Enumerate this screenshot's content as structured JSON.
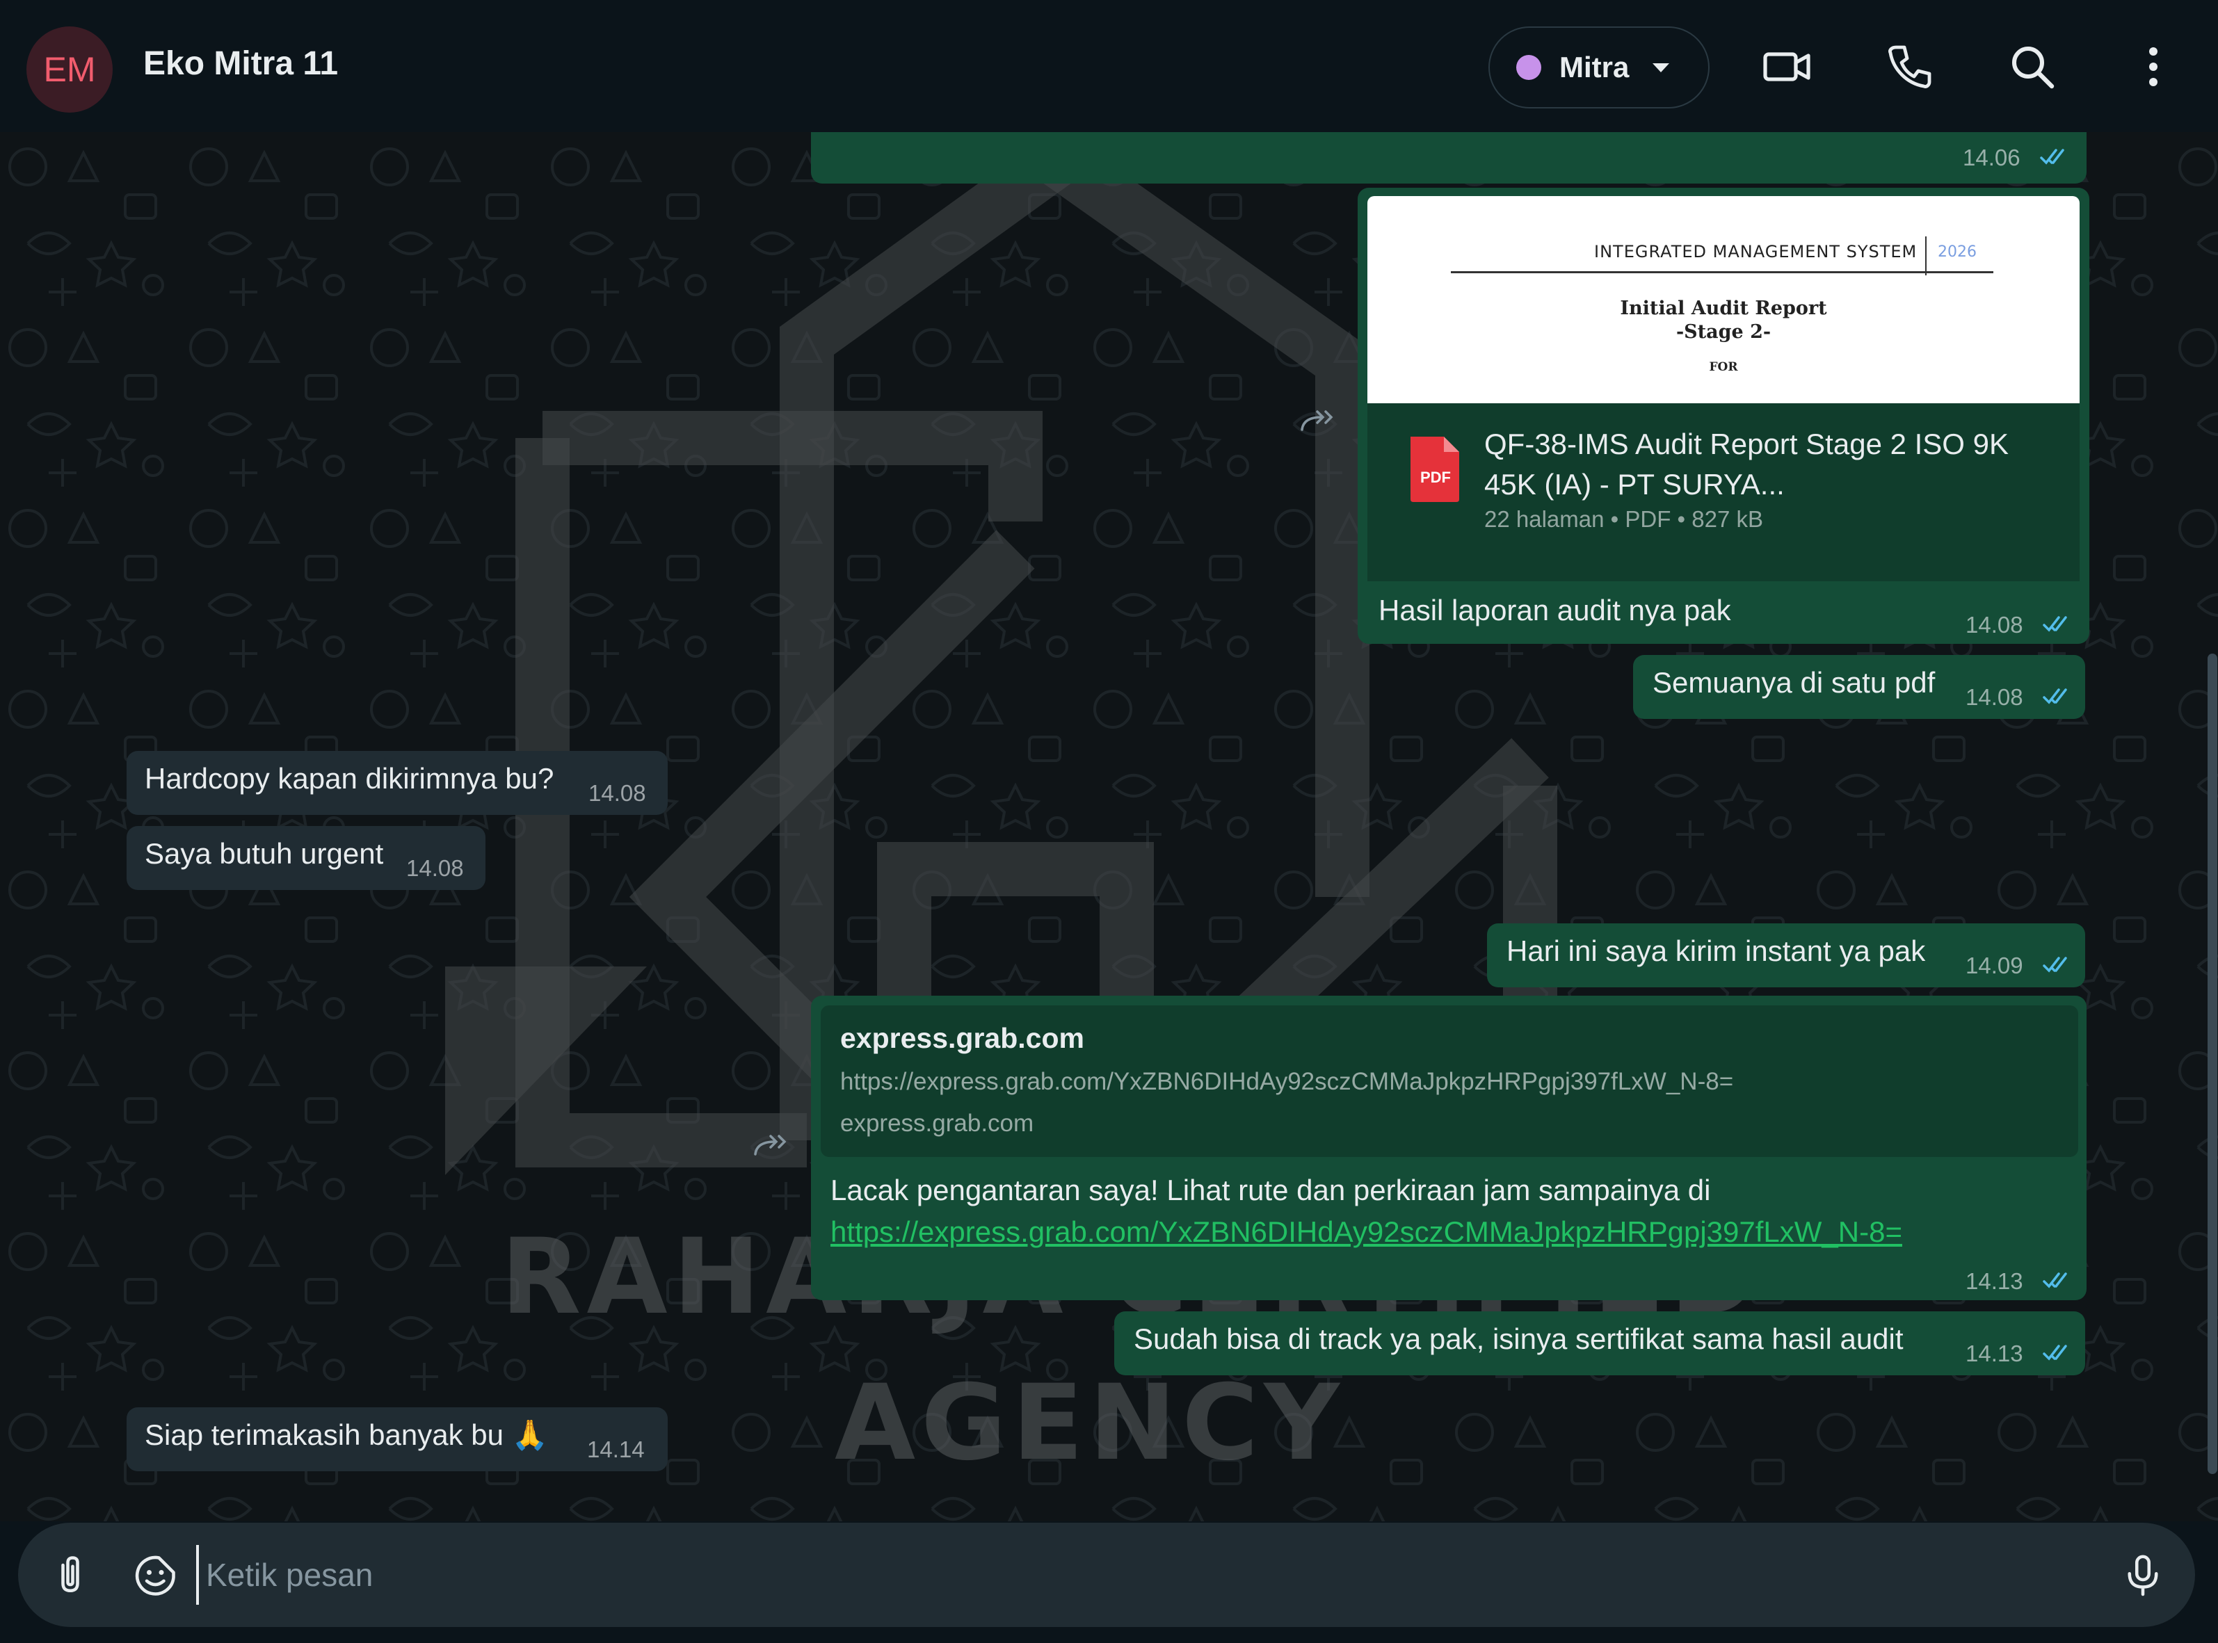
{
  "header": {
    "avatar_initials": "EM",
    "contact_name": "Eko Mitra 11",
    "label": "Mitra",
    "label_color": "#c792ea",
    "icons": [
      "video-call-icon",
      "voice-call-icon",
      "search-icon",
      "menu-icon"
    ]
  },
  "messages": [
    {
      "dir": "out",
      "time": "14.06",
      "read": true
    },
    {
      "dir": "out",
      "type": "document",
      "preview": {
        "header": "INTEGRATED MANAGEMENT SYSTEM",
        "year": "2026",
        "title_line1": "Initial Audit Report",
        "title_line2": "-Stage 2-",
        "for_label": "FOR"
      },
      "file_name": "QF-38-IMS Audit Report Stage 2 ISO 9K 45K (IA) - PT SURYA...",
      "file_meta": "22 halaman • PDF • 827 kB",
      "file_type": "PDF",
      "caption": "Hasil laporan audit nya pak",
      "time": "14.08",
      "read": true,
      "forwardable": true
    },
    {
      "dir": "out",
      "text": "Semuanya di satu pdf",
      "time": "14.08",
      "read": true
    },
    {
      "dir": "in",
      "text": "Hardcopy kapan dikirimnya bu?",
      "time": "14.08"
    },
    {
      "dir": "in",
      "text": "Saya butuh urgent",
      "time": "14.08"
    },
    {
      "dir": "out",
      "text": "Hari ini saya kirim instant ya pak",
      "time": "14.09",
      "read": true
    },
    {
      "dir": "out",
      "type": "link",
      "link_title": "express.grab.com",
      "link_url": "https://express.grab.com/YxZBN6DIHdAy92sczCMMaJpkpzHRPgpj397fLxW_N-8=",
      "link_domain": "express.grab.com",
      "text": "Lacak pengantaran saya! Lihat rute dan perkiraan jam sampainya di",
      "href_text": "https://express.grab.com/YxZBN6DIHdAy92sczCMMaJpkpzHRPgpj397fLxW_N-8=",
      "time": "14.13",
      "read": true,
      "forwardable": true
    },
    {
      "dir": "out",
      "text": "Sudah bisa di track ya pak, isinya sertifikat sama hasil audit",
      "time": "14.13",
      "read": true
    },
    {
      "dir": "in",
      "text": "Siap terimakasih banyak bu 🙏",
      "time": "14.14"
    }
  ],
  "watermark": {
    "line1": "RAHARJA CERTIFIED",
    "line2": "AGENCY"
  },
  "composer": {
    "placeholder": "Ketik pesan",
    "icons": [
      "attach-icon",
      "sticker-icon",
      "microphone-icon"
    ]
  },
  "colors": {
    "outgoing_bubble": "#144d37",
    "incoming_bubble": "#202c33",
    "read_ticks": "#53bdeb",
    "link": "#21c063"
  }
}
